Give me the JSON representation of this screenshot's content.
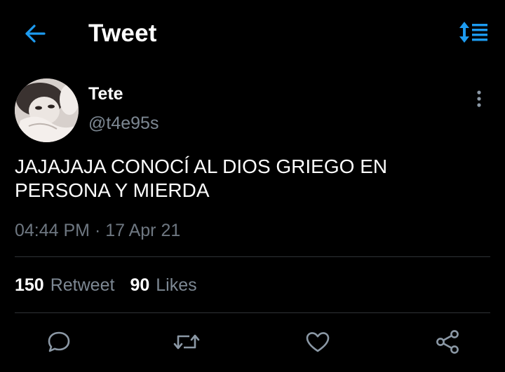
{
  "header": {
    "title": "Tweet",
    "back_icon": "arrow-left-icon",
    "sort_icon": "sort-lines-icon",
    "accent_color": "#1d9bf0"
  },
  "author": {
    "display_name": "Tete",
    "handle": "@t4e95s",
    "avatar": "avatar-photo",
    "more_icon": "more-vertical-icon"
  },
  "tweet": {
    "text": "JAJAJAJA CONOCÍ AL DIOS GRIEGO EN\nPERSONA Y MIERDA",
    "time": "04:44 PM · 17 Apr 21"
  },
  "stats": {
    "retweets_count": "150",
    "retweets_label": "Retweet",
    "likes_count": "90",
    "likes_label": "Likes"
  },
  "actions": {
    "reply_icon": "reply-icon",
    "retweet_icon": "retweet-icon",
    "like_icon": "heart-icon",
    "share_icon": "share-icon"
  },
  "colors": {
    "background": "#000000",
    "text": "#ffffff",
    "muted": "#7d8893",
    "divider": "#2f3336",
    "icon": "#8b98a5"
  }
}
